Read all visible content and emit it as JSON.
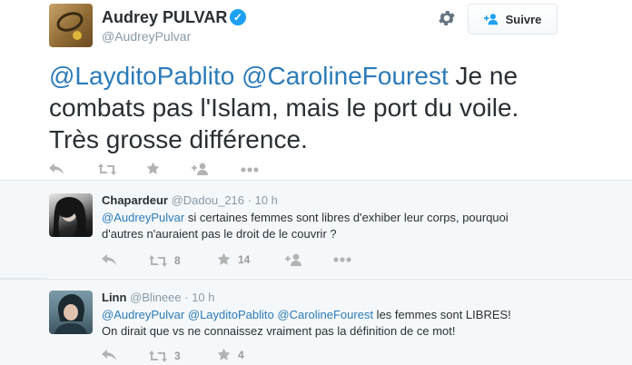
{
  "tweet": {
    "fullname": "Audrey PULVAR",
    "username": "@AudreyPulvar",
    "follow_label": "Suivre",
    "mention1": "@LayditoPablito",
    "mention2": "@CarolineFourest",
    "text_line1_rest": " Je ne",
    "text_line2": "combats pas l'Islam, mais le port du voile.",
    "text_line3": "Très grosse différence."
  },
  "replies": [
    {
      "name": "Chapardeur",
      "handle": "@Dadou_216",
      "time": "· 10 h",
      "mention": "@AudreyPulvar",
      "text1": " si certaines femmes sont libres d'exhiber leur corps, pourquoi",
      "text2": "d'autres n'auraient pas le droit de le couvrir ?",
      "retweets": "8",
      "favorites": "14"
    },
    {
      "name": "Linn",
      "handle": "@Blineee",
      "time": "· 10 h",
      "mention1": "@AudreyPulvar",
      "mention2": "@LayditoPablito",
      "mention3": "@CarolineFourest",
      "text1": " les femmes sont LIBRES!",
      "text2": "On dirait que vs ne connaissez vraiment pas la définition de ce mot!",
      "retweets": "3",
      "favorites": "4"
    }
  ],
  "colors": {
    "link": "#2b7bb9",
    "text": "#292f33",
    "muted": "#8899a6",
    "verified": "#1da1f2",
    "icon": "#b3b3b3"
  },
  "icons": [
    "gear-icon",
    "follow-person-icon",
    "verified-icon",
    "reply-icon",
    "retweet-icon",
    "favorite-icon",
    "follow-icon",
    "more-icon"
  ]
}
